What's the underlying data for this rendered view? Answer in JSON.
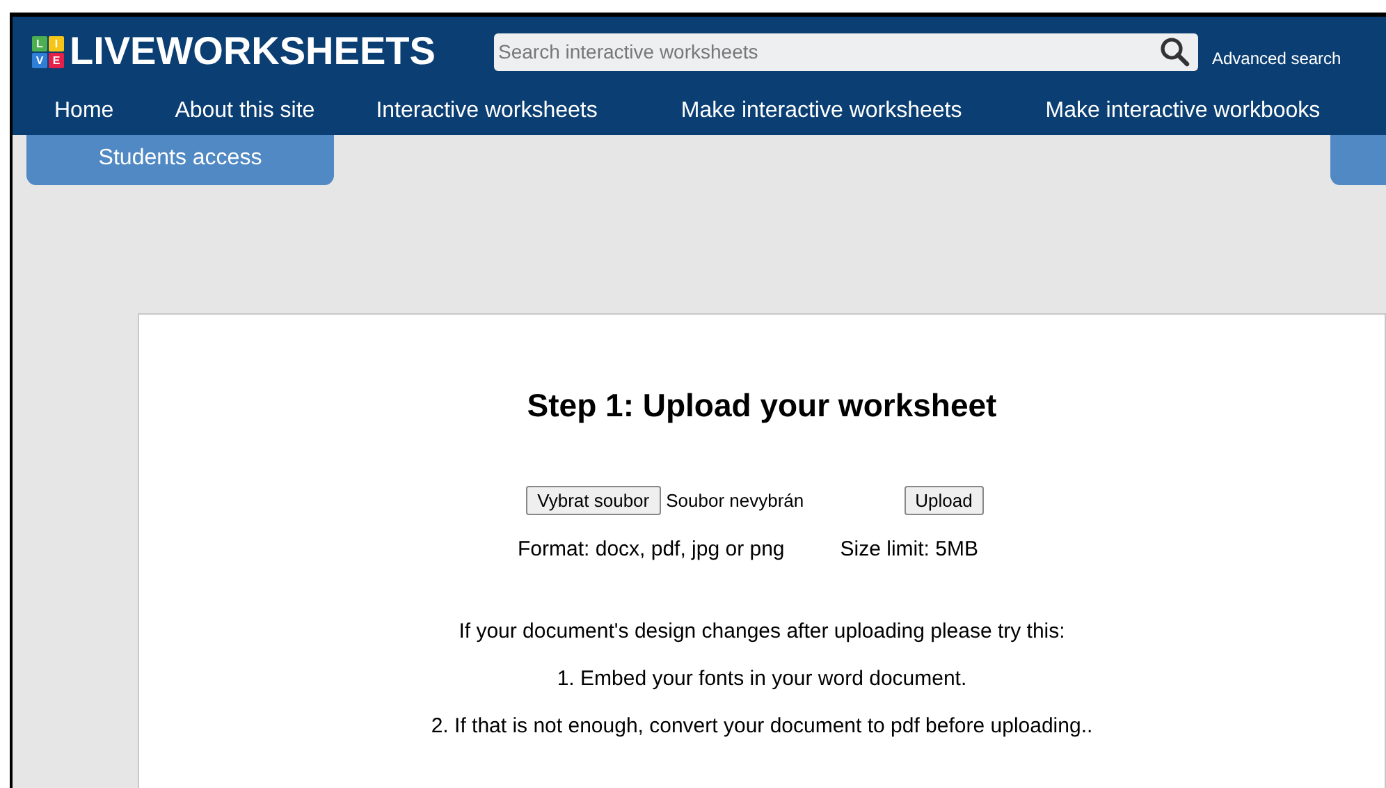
{
  "logo": {
    "tiles": [
      {
        "letter": "L",
        "color": "#4caf50"
      },
      {
        "letter": "I",
        "color": "#f5c518"
      },
      {
        "letter": "V",
        "color": "#2f7fd8"
      },
      {
        "letter": "E",
        "color": "#e5214a"
      }
    ],
    "text": "LIVEWORKSHEETS"
  },
  "search": {
    "placeholder": "Search interactive worksheets"
  },
  "advanced_search": "Advanced search",
  "nav": [
    "Home",
    "About this site",
    "Interactive worksheets",
    "Make interactive worksheets",
    "Make interactive workbooks"
  ],
  "students_access": "Students access",
  "upload": {
    "title": "Step 1: Upload your worksheet",
    "file_button": "Vybrat soubor",
    "file_status": "Soubor nevybrán",
    "upload_button": "Upload",
    "format": "Format: docx, pdf, jpg or png",
    "size_limit": "Size limit: 5MB"
  },
  "tips": [
    "If your document's design changes after uploading please try this:",
    "1. Embed your fonts in your word document.",
    "2. If that is not enough, convert your document to pdf before uploading.."
  ]
}
